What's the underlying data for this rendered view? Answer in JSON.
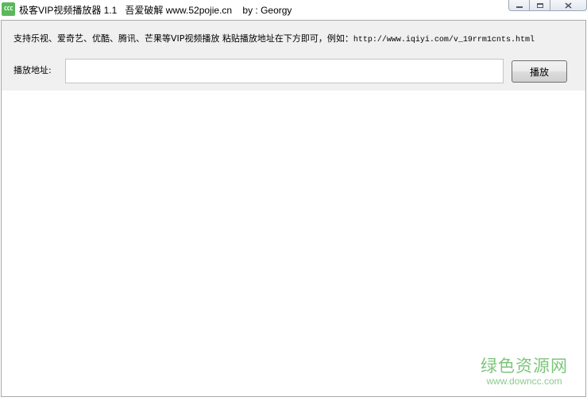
{
  "window": {
    "icon_text": "CCC",
    "title": "极客VIP视频播放器 1.1   吾爱破解 www.52pojie.cn    by : Georgy"
  },
  "toolbar": {
    "hint_cn": "支持乐视、爱奇艺、优酷、腾讯、芒果等VIP视频播放 粘贴播放地址在下方即可，例如：",
    "hint_url": "http://www.iqiyi.com/v_19rrm1cnts.html",
    "address_label": "播放地址:",
    "address_value": "",
    "address_placeholder": "",
    "play_label": "播放"
  },
  "watermark": {
    "cn": "绿色资源网",
    "url": "www.downcc.com"
  },
  "colors": {
    "panel_bg": "#f0f0f0",
    "watermark_green": "#7cc67a"
  }
}
